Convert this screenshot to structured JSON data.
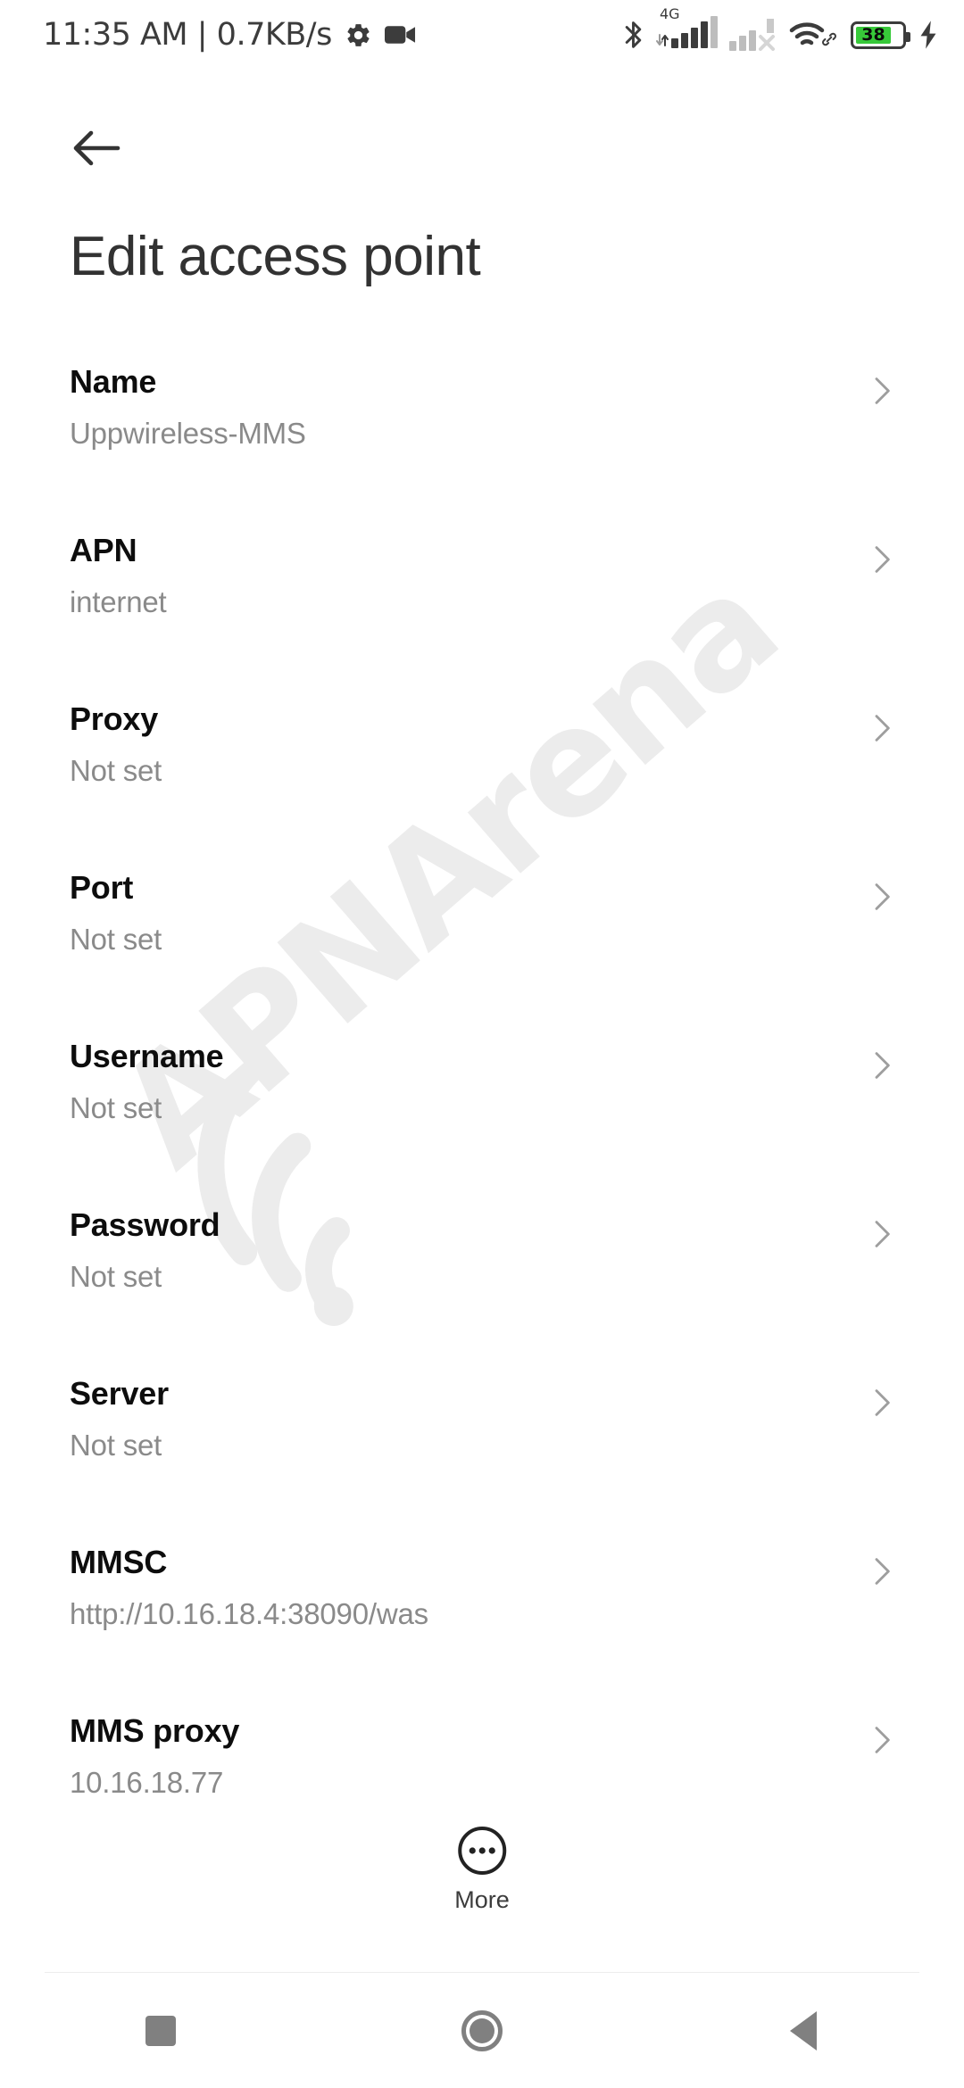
{
  "status_bar": {
    "clock": "11:35 AM | 0.7KB/s",
    "icons_left": [
      "gear-icon",
      "video-camera-icon"
    ],
    "bluetooth": "bluetooth-icon",
    "sim1_network": "4G",
    "sim1_signal_bars": 4,
    "sim2_signal_bars": 2,
    "sim2_state": "no-service",
    "wifi": "wifi-icon",
    "wifi_badge": "link-icon",
    "battery_percent": "38",
    "battery_charging": true,
    "battery_color": "#37c939"
  },
  "header": {
    "back_icon": "arrow-left-icon",
    "title": "Edit access point"
  },
  "list": {
    "chevron_icon": "chevron-right-icon",
    "rows": [
      {
        "title": "Name",
        "value": "Uppwireless-MMS"
      },
      {
        "title": "APN",
        "value": "internet"
      },
      {
        "title": "Proxy",
        "value": "Not set"
      },
      {
        "title": "Port",
        "value": "Not set"
      },
      {
        "title": "Username",
        "value": "Not set"
      },
      {
        "title": "Password",
        "value": "Not set"
      },
      {
        "title": "Server",
        "value": "Not set"
      },
      {
        "title": "MMSC",
        "value": "http://10.16.18.4:38090/was"
      },
      {
        "title": "MMS proxy",
        "value": "10.16.18.77"
      }
    ]
  },
  "more_button": {
    "label": "More",
    "icon": "overflow-circle-icon"
  },
  "watermark": {
    "text": "APNArena",
    "color": "#ececec"
  },
  "navigation_bar": {
    "recents": "square-icon",
    "home": "circle-icon",
    "back": "triangle-left-icon"
  }
}
